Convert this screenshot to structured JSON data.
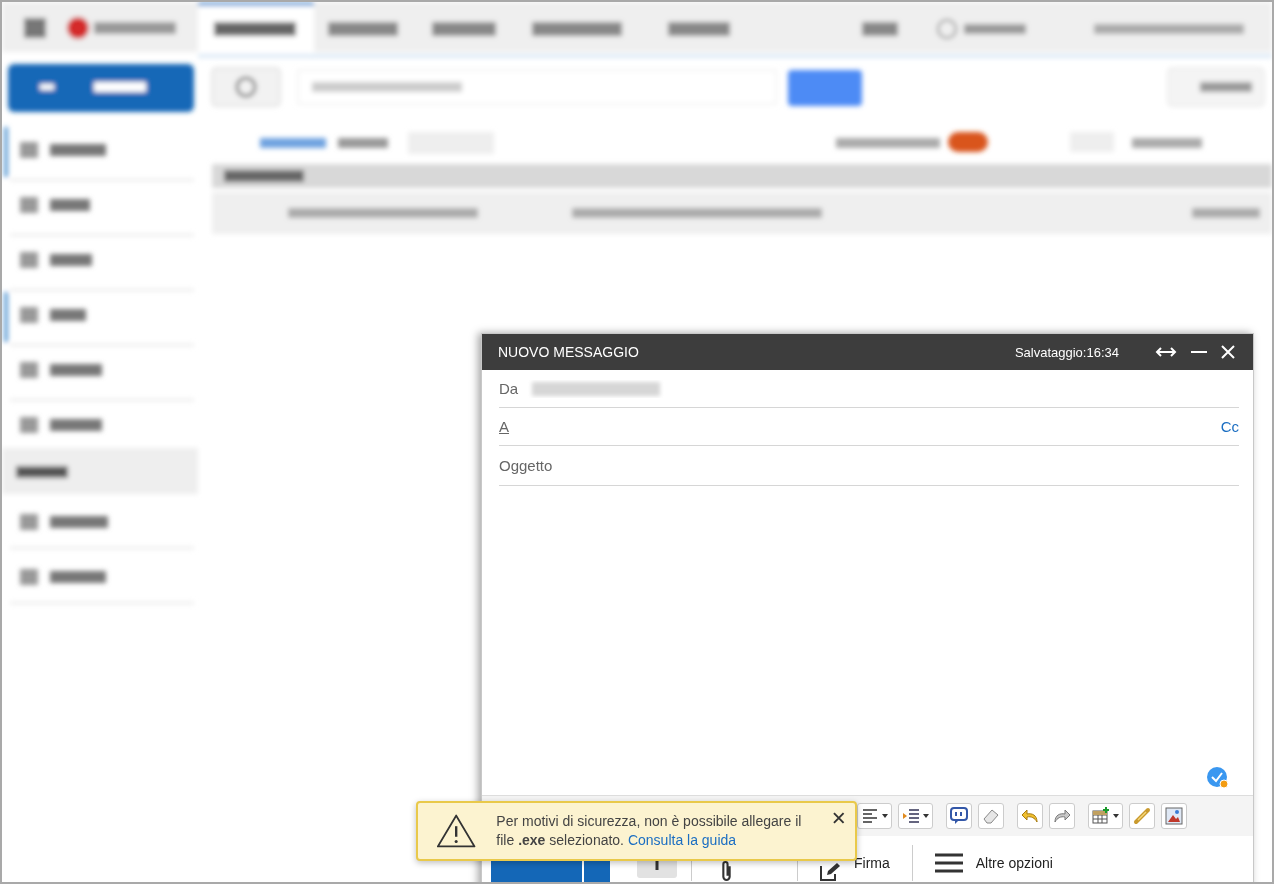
{
  "compose": {
    "title": "NUOVO MESSAGGIO",
    "saved": "Salvataggio:16:34",
    "fields": [
      {
        "label": "Da",
        "kind": "from"
      },
      {
        "label": "A",
        "kind": "to",
        "link": "Cc"
      },
      {
        "label": "Oggetto",
        "kind": "subject"
      }
    ],
    "toolbar": [
      {
        "kind": "align",
        "dropdown": true
      },
      {
        "kind": "indent",
        "dropdown": true
      },
      {
        "kind": "comment",
        "dropdown": false
      },
      {
        "kind": "eraser",
        "dropdown": false
      },
      {
        "kind": "undo",
        "dropdown": false
      },
      {
        "kind": "redo",
        "dropdown": false
      },
      {
        "kind": "table",
        "dropdown": true
      },
      {
        "kind": "link",
        "dropdown": false
      },
      {
        "kind": "image",
        "dropdown": false
      }
    ],
    "actions": [
      {
        "kind": "send"
      },
      {
        "kind": "format"
      },
      {
        "kind": "attach"
      },
      {
        "kind": "signature",
        "label": "Firma"
      },
      {
        "kind": "more",
        "label": "Altre opzioni"
      }
    ]
  },
  "toast": {
    "text": "Per motivi di sicurezza, non è possibile allegare il file **.exe** selezionato.",
    "link": "Consulta la guida"
  }
}
